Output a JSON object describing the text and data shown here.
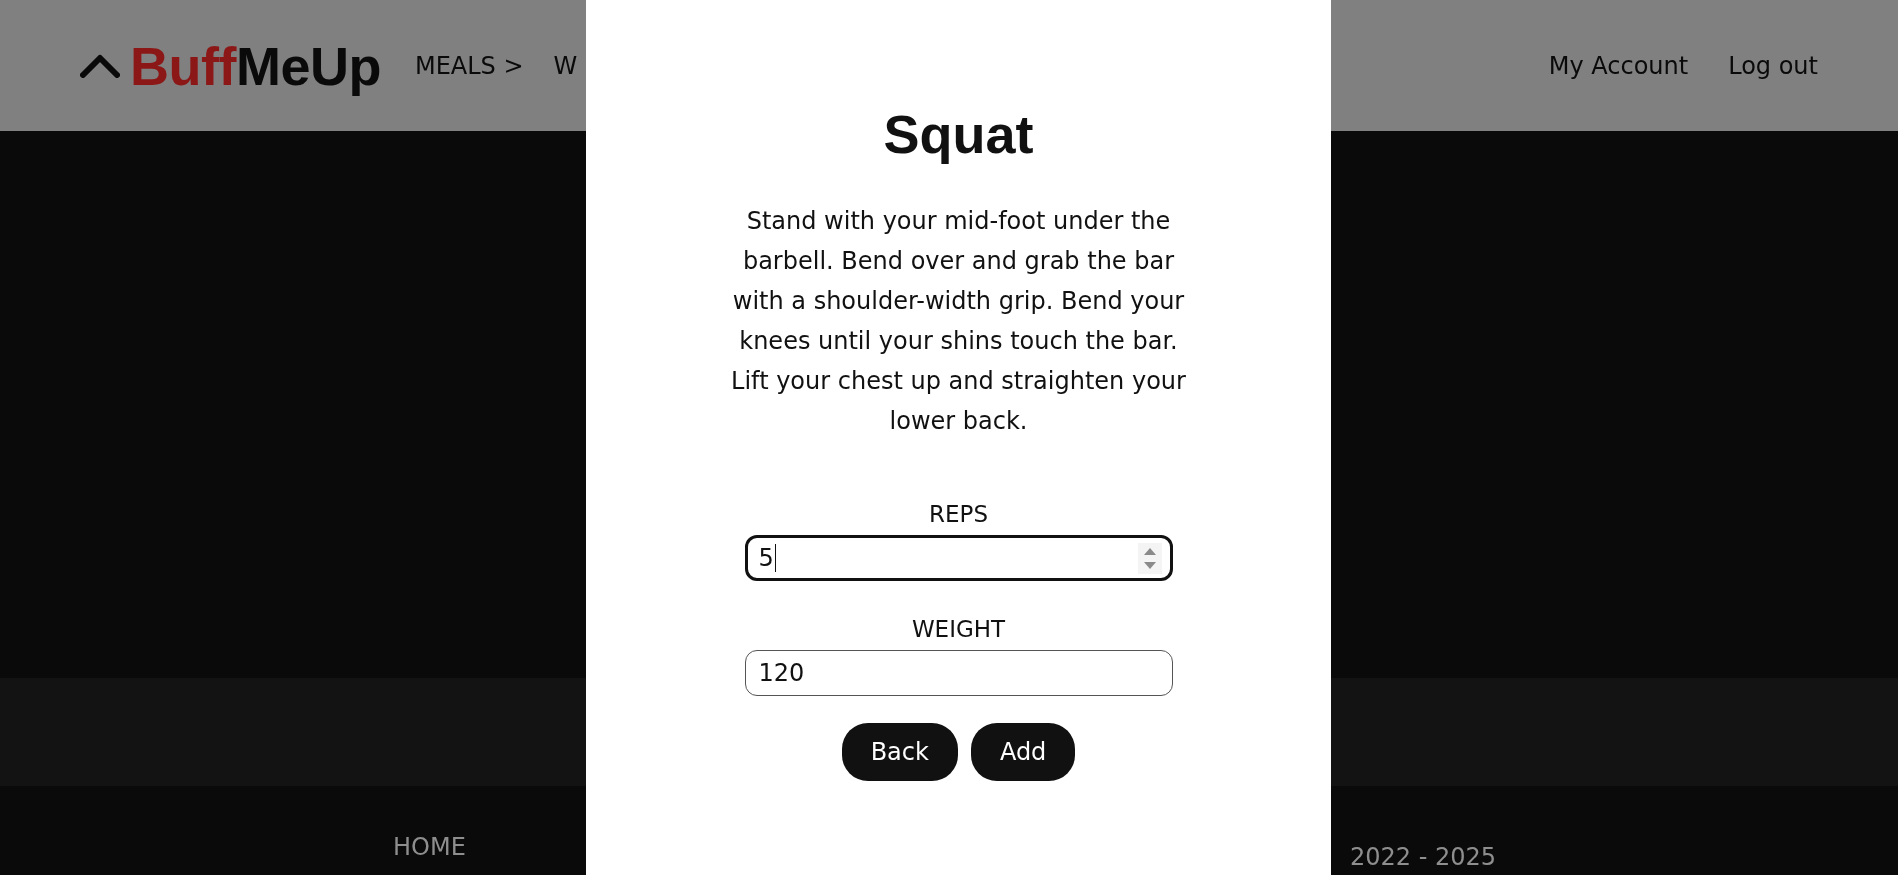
{
  "header": {
    "logo": {
      "accent": "Buff",
      "rest": "MeUp"
    },
    "nav": [
      "MEALS >",
      "W"
    ],
    "account_links": [
      "My Account",
      "Log out"
    ]
  },
  "modal": {
    "title": "Squat",
    "description": "Stand with your mid-foot under the barbell. Bend over and grab the bar with a shoulder-width grip. Bend your knees until your shins touch the bar. Lift your chest up and straighten your lower back.",
    "fields": [
      {
        "label": "REPS",
        "value": "5",
        "focused": true
      },
      {
        "label": "WEIGHT",
        "value": "120",
        "focused": false
      }
    ],
    "buttons": [
      "Back",
      "Add"
    ]
  },
  "footer": {
    "links": [
      "HOME"
    ],
    "copyright": "2022 - 2025"
  }
}
